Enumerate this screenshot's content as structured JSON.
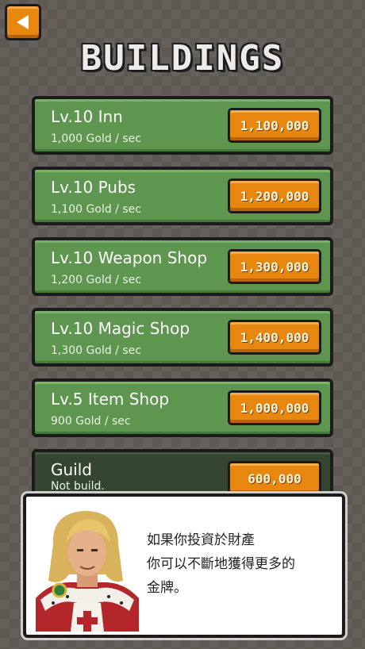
{
  "title": "BUILDINGS",
  "buildings": [
    {
      "name": "Lv.10 Inn",
      "rate": "1,000 Gold / sec",
      "price": "1,100,000"
    },
    {
      "name": "Lv.10 Pubs",
      "rate": "1,100 Gold / sec",
      "price": "1,200,000"
    },
    {
      "name": "Lv.10 Weapon Shop",
      "rate": "1,200 Gold / sec",
      "price": "1,300,000"
    },
    {
      "name": "Lv.10 Magic Shop",
      "rate": "1,300 Gold / sec",
      "price": "1,400,000"
    },
    {
      "name": "Lv.5 Item Shop",
      "rate": "900 Gold / sec",
      "price": "1,000,000"
    },
    {
      "name": "Guild",
      "rate": "Not build.",
      "price": "600,000"
    }
  ],
  "dialog": {
    "lines": [
      "如果你投資於財產",
      "你可以不斷地獲得更多的",
      "金牌。"
    ]
  },
  "colors": {
    "button_orange": "#e8870f",
    "row_green": "#5e9650",
    "row_dark_green": "#34462f",
    "background": "#5e5853"
  }
}
